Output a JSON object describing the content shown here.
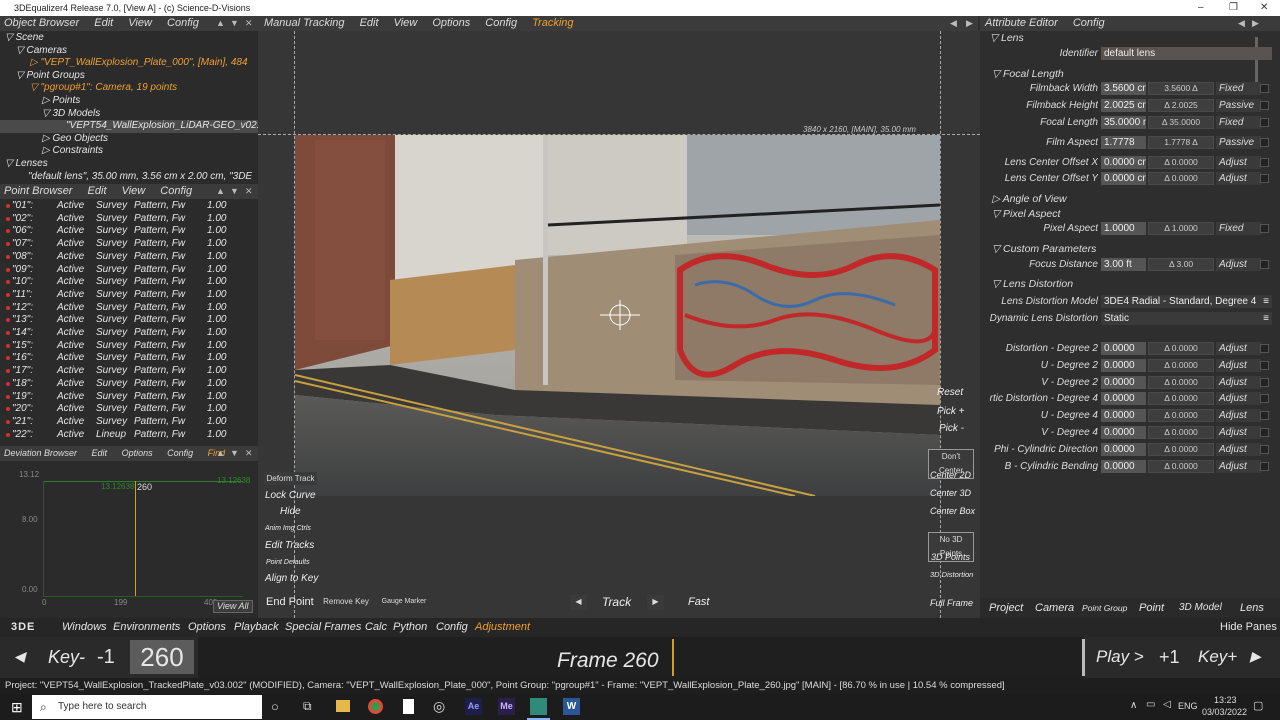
{
  "window": {
    "title": "3DEqualizer4 Release 7.0, [View A] - (c) Science-D-Visions",
    "controls": [
      "–",
      "❐",
      "✕"
    ]
  },
  "object_browser": {
    "menu": [
      "Object Browser",
      "Edit",
      "View",
      "Config"
    ],
    "tree": [
      "Scene",
      "Cameras",
      "\"VEPT_WallExplosion_Plate_000\", [Main], 484",
      "Point Groups",
      "\"pgroup#1\": Camera, 19 points",
      "Points",
      "3D Models",
      "\"VEPT54_WallExplosion_LiDAR-GEO_v02.",
      "Geo Objects",
      "Constraints",
      "Lenses",
      "\"default lens\", 35.00 mm, 3.56 cm x 2.00 cm, \"3DE"
    ]
  },
  "point_browser": {
    "menu": [
      "Point Browser",
      "Edit",
      "View",
      "Config"
    ],
    "rows": [
      [
        "\"01\":",
        "Active",
        "Survey",
        "Pattern, Fw",
        "1.00"
      ],
      [
        "\"02\":",
        "Active",
        "Survey",
        "Pattern, Fw",
        "1.00"
      ],
      [
        "\"06\":",
        "Active",
        "Survey",
        "Pattern, Fw",
        "1.00"
      ],
      [
        "\"07\":",
        "Active",
        "Survey",
        "Pattern, Fw",
        "1.00"
      ],
      [
        "\"08\":",
        "Active",
        "Survey",
        "Pattern, Fw",
        "1.00"
      ],
      [
        "\"09\":",
        "Active",
        "Survey",
        "Pattern, Fw",
        "1.00"
      ],
      [
        "\"10\":",
        "Active",
        "Survey",
        "Pattern, Fw",
        "1.00"
      ],
      [
        "\"11\":",
        "Active",
        "Survey",
        "Pattern, Fw",
        "1.00"
      ],
      [
        "\"12\":",
        "Active",
        "Survey",
        "Pattern, Fw",
        "1.00"
      ],
      [
        "\"13\":",
        "Active",
        "Survey",
        "Pattern, Fw",
        "1.00"
      ],
      [
        "\"14\":",
        "Active",
        "Survey",
        "Pattern, Fw",
        "1.00"
      ],
      [
        "\"15\":",
        "Active",
        "Survey",
        "Pattern, Fw",
        "1.00"
      ],
      [
        "\"16\":",
        "Active",
        "Survey",
        "Pattern, Fw",
        "1.00"
      ],
      [
        "\"17\":",
        "Active",
        "Survey",
        "Pattern, Fw",
        "1.00"
      ],
      [
        "\"18\":",
        "Active",
        "Survey",
        "Pattern, Fw",
        "1.00"
      ],
      [
        "\"19\":",
        "Active",
        "Survey",
        "Pattern, Fw",
        "1.00"
      ],
      [
        "\"20\":",
        "Active",
        "Survey",
        "Pattern, Fw",
        "1.00"
      ],
      [
        "\"21\":",
        "Active",
        "Survey",
        "Pattern, Fw",
        "1.00"
      ],
      [
        "\"22\":",
        "Active",
        "Lineup",
        "Pattern, Fw",
        "1.00"
      ]
    ]
  },
  "deviation_browser": {
    "menu": [
      "Deviation Browser",
      "Edit",
      "Options",
      "Config",
      "Find"
    ],
    "ymax": "13.12",
    "ymid": "8.00",
    "ymin": "0.00",
    "xstart": "0",
    "xmid": "199",
    "xend": "400",
    "marker_label": "13.12638",
    "frame": "260",
    "right_label": "13.12638",
    "view_all": "View All"
  },
  "tracking": {
    "menu": [
      "Manual Tracking",
      "Edit",
      "View",
      "Options",
      "Config",
      "Tracking"
    ],
    "image_info": "3840 x 2160, [MAIN], 35.00 mm",
    "left_buttons": [
      "Deform Track",
      "Lock Curve",
      "Hide",
      "Anim Img Ctrls",
      "Edit Tracks",
      "Point Defaults",
      "Align to Key"
    ],
    "right_buttons": [
      "Reset",
      "Pick +",
      "Pick -",
      "Don't Center",
      "Center 2D",
      "Center 3D",
      "Center Box",
      "No 3D Points",
      "3D Points",
      "3D Distortion",
      "Full Frame"
    ],
    "bottom": {
      "end_point": "End Point",
      "remove_key": "Remove Key",
      "gauge_marker": "Gauge Marker",
      "track": "Track",
      "fast": "Fast"
    }
  },
  "attribute_editor": {
    "menu": [
      "Attribute Editor",
      "Config"
    ],
    "lens_header": "Lens",
    "identifier_label": "Identifier",
    "identifier_value": "default lens",
    "sections": {
      "focal": "Focal Length",
      "angle": "Angle of View",
      "pixel": "Pixel Aspect",
      "custom": "Custom Parameters",
      "distortion": "Lens Distortion"
    },
    "focal_rows": [
      {
        "label": "Filmback Width",
        "value": "3.5600 cn",
        "slider": "3.5600 Δ",
        "mode": "Fixed"
      },
      {
        "label": "Filmback Height",
        "value": "2.0025 cn",
        "slider": "Δ 2.0025",
        "mode": "Passive"
      },
      {
        "label": "Focal Length",
        "value": "35.0000 n",
        "slider": "Δ 35.0000",
        "mode": "Fixed"
      },
      {
        "label": "Film Aspect",
        "value": "1.7778",
        "slider": "1.7778 Δ",
        "mode": "Passive"
      },
      {
        "label": "Lens Center Offset X",
        "value": "0.0000 cn",
        "slider": "Δ 0.0000",
        "mode": "Adjust"
      },
      {
        "label": "Lens Center Offset Y",
        "value": "0.0000 cn",
        "slider": "Δ 0.0000",
        "mode": "Adjust"
      }
    ],
    "pixel_row": {
      "label": "Pixel Aspect",
      "value": "1.0000",
      "slider": "Δ 1.0000",
      "mode": "Fixed"
    },
    "focus_row": {
      "label": "Focus Distance",
      "value": "3.00 ft",
      "slider": "Δ 3.00",
      "mode": "Adjust"
    },
    "model_label": "Lens Distortion Model",
    "model_value": "3DE4 Radial - Standard, Degree 4",
    "dynamic_label": "Dynamic Lens Distortion",
    "dynamic_value": "Static",
    "dist_rows": [
      {
        "label": "Distortion - Degree 2",
        "value": "0.0000",
        "slider": "Δ 0.0000",
        "mode": "Adjust"
      },
      {
        "label": "U - Degree 2",
        "value": "0.0000",
        "slider": "Δ 0.0000",
        "mode": "Adjust"
      },
      {
        "label": "V - Degree 2",
        "value": "0.0000",
        "slider": "Δ 0.0000",
        "mode": "Adjust"
      },
      {
        "label": "rtic Distortion - Degree 4",
        "value": "0.0000",
        "slider": "Δ 0.0000",
        "mode": "Adjust"
      },
      {
        "label": "U - Degree 4",
        "value": "0.0000",
        "slider": "Δ 0.0000",
        "mode": "Adjust"
      },
      {
        "label": "V - Degree 4",
        "value": "0.0000",
        "slider": "Δ 0.0000",
        "mode": "Adjust"
      },
      {
        "label": "Phi - Cylindric Direction",
        "value": "0.0000",
        "slider": "Δ 0.0000",
        "mode": "Adjust"
      },
      {
        "label": "B - Cylindric Bending",
        "value": "0.0000",
        "slider": "Δ 0.0000",
        "mode": "Adjust"
      }
    ],
    "tabs": [
      "Project",
      "Camera",
      "Point Group",
      "Point",
      "3D Model",
      "Lens"
    ]
  },
  "main_menu": {
    "logo": "3DE",
    "items": [
      "Windows",
      "Environments",
      "Options",
      "Playback",
      "Special Frames",
      "Calc",
      "Python",
      "Config",
      "Adjustment"
    ],
    "hide_panes": "Hide Panes"
  },
  "timeline": {
    "key_prev": "Key-",
    "minus1": "-1",
    "frame_num": "260",
    "frame_label": "Frame 260",
    "play": "Play >",
    "plus1": "+1",
    "key_next": "Key+"
  },
  "status": "Project: \"VEPT54_WallExplosion_TrackedPlate_v03.002\" (MODIFIED), Camera: \"VEPT_WallExplosion_Plate_000\", Point Group: \"pgroup#1\" - Frame: \"VEPT_WallExplosion_Plate_260.jpg\" [MAIN] - [86.70 % in use | 10.54 % compressed]",
  "taskbar": {
    "search": "Type here to search",
    "lang": "ENG",
    "time": "13:23",
    "date": "03/03/2022"
  }
}
